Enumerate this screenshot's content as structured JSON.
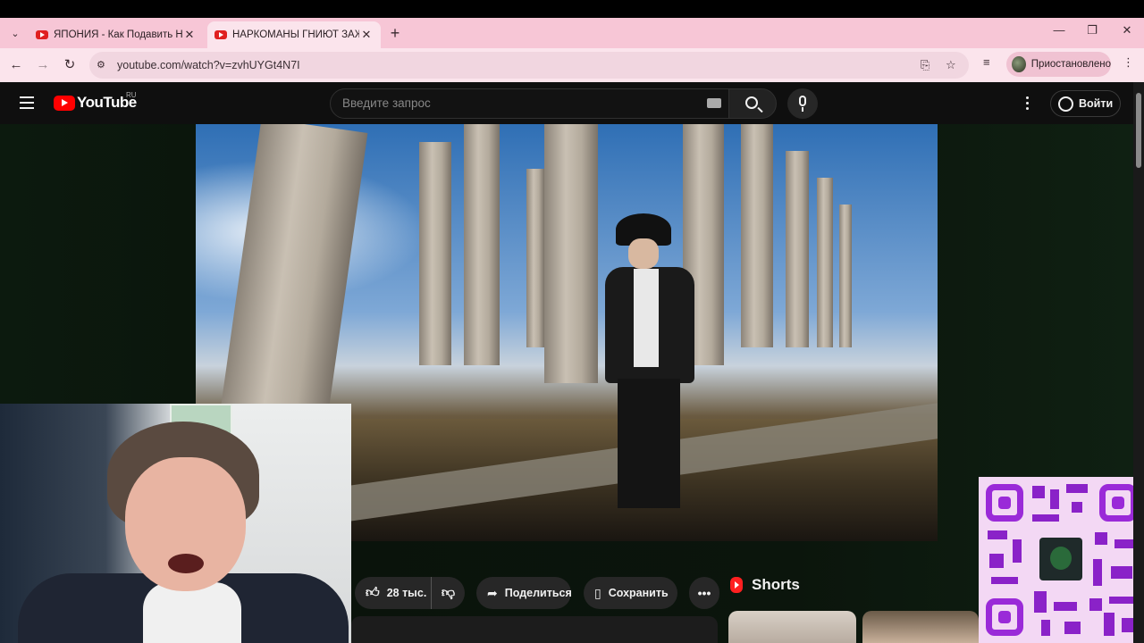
{
  "browser": {
    "tabs": [
      {
        "title": "ЯПОНИЯ - Как Подавить Наци",
        "close": "✕"
      },
      {
        "title": "НАРКОМАНЫ ГНИЮТ ЗАЖИВО",
        "close": "✕"
      }
    ],
    "new_tab": "+",
    "window_controls": {
      "minimize": "—",
      "restore": "❐",
      "close": "✕"
    },
    "nav": {
      "back": "←",
      "forward": "→",
      "reload": "↻"
    },
    "url": "youtube.com/watch?v=zvhUYGt4N7I",
    "profile_label": "Приостановлено",
    "menu": "⋮"
  },
  "youtube": {
    "logo_text": "YouTube",
    "logo_region": "RU",
    "search_placeholder": "Введите запрос",
    "signin_label": "Войти"
  },
  "actions": {
    "likes": "28 тыс.",
    "share_label": "Поделиться",
    "save_label": "Сохранить",
    "more": "•••"
  },
  "shorts": {
    "label": "Shorts"
  },
  "colors": {
    "tabstrip": "#f7c6d6",
    "toolbar": "#fbe4ec",
    "yt_red": "#ff0000",
    "qr_purple": "#8a22c8"
  }
}
